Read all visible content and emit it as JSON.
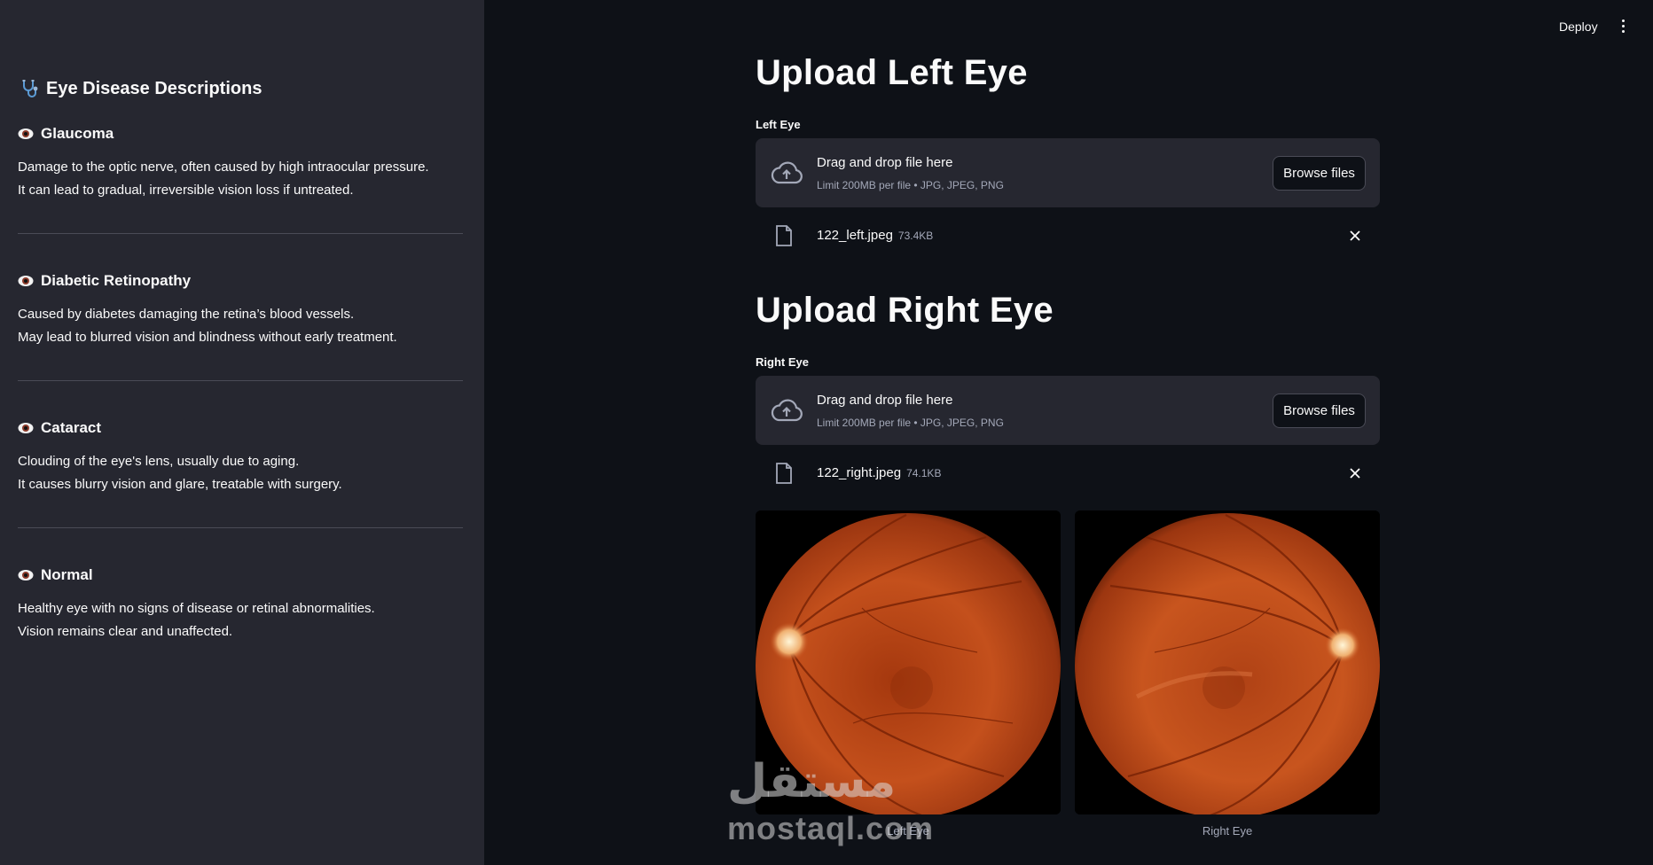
{
  "header": {
    "deploy_label": "Deploy",
    "menu_icon": "more-vertical-icon"
  },
  "sidebar": {
    "title": "Eye Disease Descriptions",
    "title_icon": "stethoscope-icon",
    "diseases": [
      {
        "name": "Glaucoma",
        "icon": "eye-icon",
        "line1": "Damage to the optic nerve, often caused by high intraocular pressure.",
        "line2": "It can lead to gradual, irreversible vision loss if untreated."
      },
      {
        "name": "Diabetic Retinopathy",
        "icon": "eye-icon",
        "line1": "Caused by diabetes damaging the retina’s blood vessels.",
        "line2": "May lead to blurred vision and blindness without early treatment."
      },
      {
        "name": "Cataract",
        "icon": "eye-icon",
        "line1": "Clouding of the eye's lens, usually due to aging.",
        "line2": "It causes blurry vision and glare, treatable with surgery."
      },
      {
        "name": "Normal",
        "icon": "eye-icon",
        "line1": "Healthy eye with no signs of disease or retinal abnormalities.",
        "line2": "Vision remains clear and unaffected."
      }
    ]
  },
  "left_upload": {
    "heading": "Upload Left Eye",
    "label": "Left Eye",
    "dropzone_title": "Drag and drop file here",
    "dropzone_limit": "Limit 200MB per file • JPG, JPEG, PNG",
    "browse_label": "Browse files",
    "file_name": "122_left.jpeg",
    "file_size": "73.4KB"
  },
  "right_upload": {
    "heading": "Upload Right Eye",
    "label": "Right Eye",
    "dropzone_title": "Drag and drop file here",
    "dropzone_limit": "Limit 200MB per file • JPG, JPEG, PNG",
    "browse_label": "Browse files",
    "file_name": "122_right.jpeg",
    "file_size": "74.1KB"
  },
  "images": {
    "left_caption": "Left Eye",
    "right_caption": "Right Eye"
  },
  "watermark": {
    "latin": "mostaql.com",
    "arabic": "مستقل"
  },
  "colors": {
    "app_bg": "#0e1117",
    "sidebar_bg": "#262730",
    "dropzone_bg": "#262730",
    "muted_text": "#a3a8b8",
    "fundus_orange": "#c4501c"
  }
}
